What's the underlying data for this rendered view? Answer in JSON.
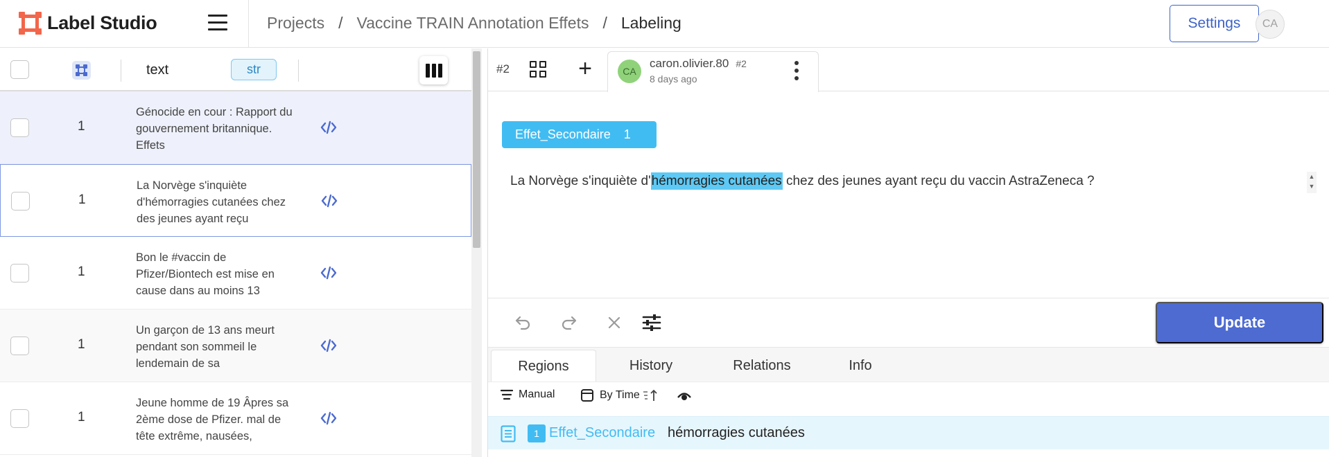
{
  "app": {
    "name": "Label Studio"
  },
  "breadcrumb": {
    "projects": "Projects",
    "sep": "/",
    "project": "Vaccine TRAIN Annotation Effets",
    "page": "Labeling"
  },
  "header": {
    "settings_label": "Settings",
    "user_initials": "CA"
  },
  "table": {
    "column_text": "text",
    "column_type": "str",
    "rows": [
      {
        "annotations": "1",
        "text": "Génocide en cour : Rapport du gouvernement britannique. Effets"
      },
      {
        "annotations": "1",
        "text": "La Norvège s'inquiète d'hémorragies cutanées chez des jeunes ayant reçu"
      },
      {
        "annotations": "1",
        "text": "Bon le #vaccin de Pfizer/Biontech est mise en cause dans au moins 13"
      },
      {
        "annotations": "1",
        "text": "Un garçon de 13 ans meurt pendant son sommeil le lendemain de sa"
      },
      {
        "annotations": "1",
        "text": "Jeune homme de 19 Âpres sa 2ème dose de Pfizer. mal de tête extrême, nausées,"
      }
    ]
  },
  "annotation": {
    "task_id": "#2",
    "user": "caron.olivier.80",
    "user_initials": "CA",
    "annotation_id": "#2",
    "time": "8 days ago"
  },
  "labels": [
    {
      "name": "Effet_Secondaire",
      "count": "1",
      "color": "#41bcf2"
    }
  ],
  "text": {
    "before": "La Norvège s'inquiète d'",
    "highlight": "hémorragies cutanées",
    "after": " chez des jeunes ayant reçu du vaccin AstraZeneca ?"
  },
  "toolbar": {
    "update_label": "Update",
    "accent": "#4d6bd1"
  },
  "tabs": [
    "Regions",
    "History",
    "Relations",
    "Info"
  ],
  "sort": {
    "manual": "Manual",
    "by_time": "By Time"
  },
  "regions": [
    {
      "index": "1",
      "label": "Effet_Secondaire",
      "text": "hémorragies cutanées"
    }
  ]
}
